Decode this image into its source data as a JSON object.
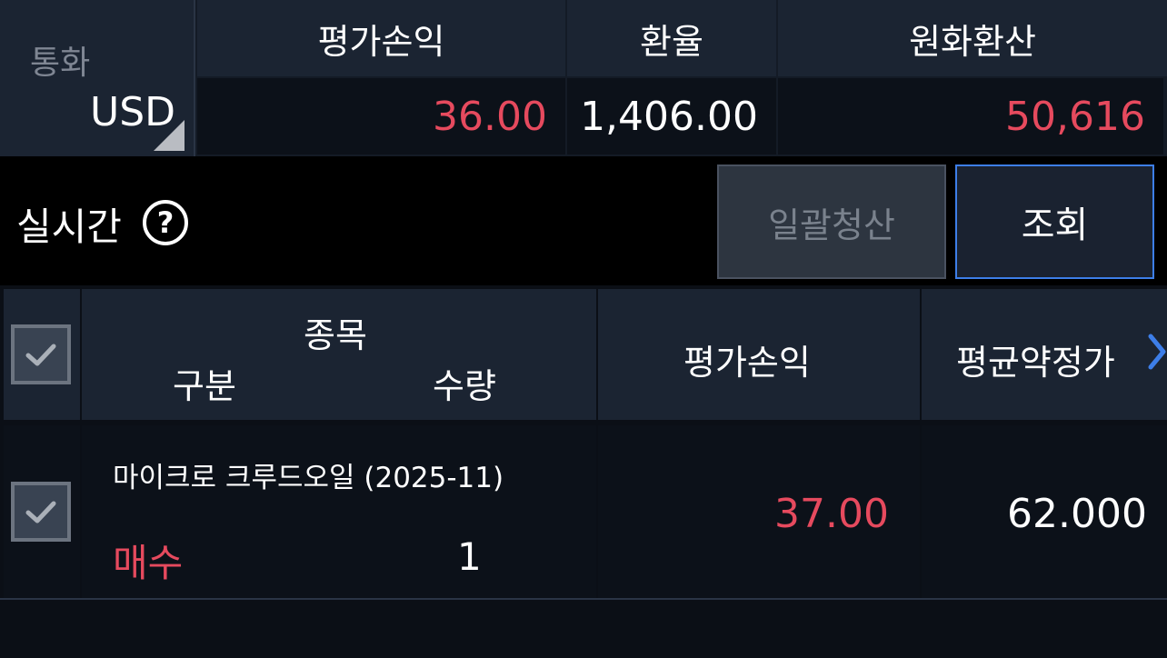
{
  "summary": {
    "currency_label": "통화",
    "currency_value": "USD",
    "headers": [
      "평가손익",
      "환율",
      "원화환산"
    ],
    "eval_pnl": "36.00",
    "exchange_rate": "1,406.00",
    "krw_converted": "50,616"
  },
  "toolbar": {
    "realtime_label": "실시간",
    "help_glyph": "?",
    "liquidate_all_label": "일괄청산",
    "query_label": "조회"
  },
  "table": {
    "headers": {
      "item": "종목",
      "side": "구분",
      "quantity": "수량",
      "eval_pnl": "평가손익",
      "avg_price": "평균약정가"
    },
    "rows": [
      {
        "item": "마이크로 크루드오일 (2025-11)",
        "side": "매수",
        "quantity": "1",
        "eval_pnl": "37.00",
        "avg_price": "62.000"
      }
    ]
  },
  "colors": {
    "positive": "#e64a5e",
    "accent": "#3d7ee8"
  },
  "icons": [
    "help-icon",
    "checkbox-icon",
    "chevron-right-icon",
    "dropdown-corner-icon"
  ]
}
